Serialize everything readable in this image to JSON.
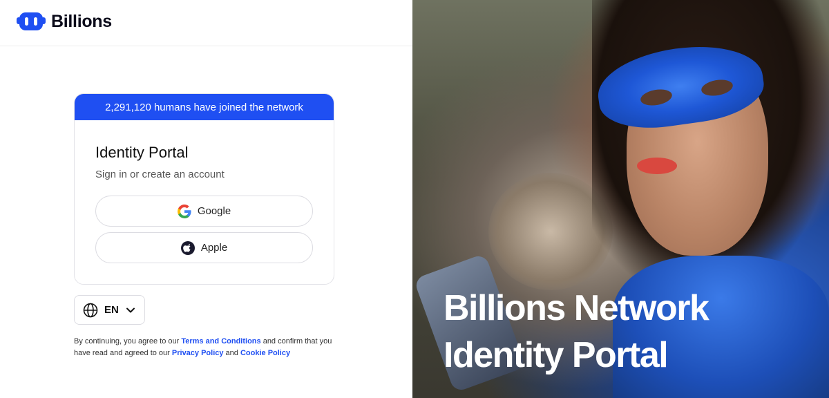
{
  "brand": {
    "name": "Billions",
    "accent": "#1f4ff2"
  },
  "card": {
    "banner": "2,291,120 humans have joined the network",
    "title": "Identity Portal",
    "subtitle": "Sign in or create an account",
    "google_label": "Google",
    "apple_label": "Apple"
  },
  "language": {
    "selected": "EN"
  },
  "legal": {
    "text_1": "By continuing, you agree to our ",
    "terms_link": "Terms and Conditions",
    "text_2": " and confirm that you have read and agreed to our ",
    "privacy_link": "Privacy Policy",
    "text_3": " and ",
    "cookie_link": "Cookie Policy"
  },
  "hero": {
    "line_1": "Billions Network",
    "line_2": "Identity Portal"
  }
}
